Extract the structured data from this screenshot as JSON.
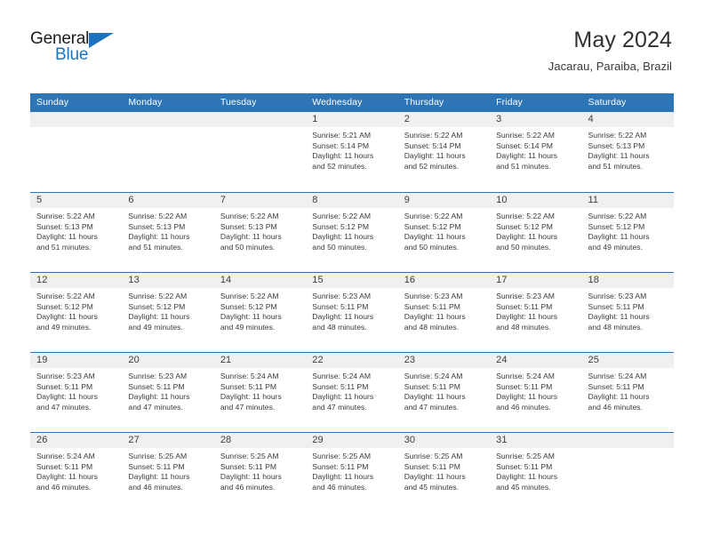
{
  "brand": {
    "name_part1": "General",
    "name_part2": "Blue",
    "logo_icon": "triangle-icon",
    "blue": "#1e73be"
  },
  "header": {
    "title": "May 2024",
    "subtitle": "Jacarau, Paraiba, Brazil"
  },
  "theme": {
    "header_blue": "#2e75b6",
    "band_gray": "#f0f0f0",
    "text": "#3a3a3a"
  },
  "calendar": {
    "day_headers": [
      "Sunday",
      "Monday",
      "Tuesday",
      "Wednesday",
      "Thursday",
      "Friday",
      "Saturday"
    ],
    "weeks": [
      [
        {
          "day": "",
          "sunrise": "",
          "sunset": "",
          "daylight1": "",
          "daylight2": ""
        },
        {
          "day": "",
          "sunrise": "",
          "sunset": "",
          "daylight1": "",
          "daylight2": ""
        },
        {
          "day": "",
          "sunrise": "",
          "sunset": "",
          "daylight1": "",
          "daylight2": ""
        },
        {
          "day": "1",
          "sunrise": "Sunrise: 5:21 AM",
          "sunset": "Sunset: 5:14 PM",
          "daylight1": "Daylight: 11 hours",
          "daylight2": "and 52 minutes."
        },
        {
          "day": "2",
          "sunrise": "Sunrise: 5:22 AM",
          "sunset": "Sunset: 5:14 PM",
          "daylight1": "Daylight: 11 hours",
          "daylight2": "and 52 minutes."
        },
        {
          "day": "3",
          "sunrise": "Sunrise: 5:22 AM",
          "sunset": "Sunset: 5:14 PM",
          "daylight1": "Daylight: 11 hours",
          "daylight2": "and 51 minutes."
        },
        {
          "day": "4",
          "sunrise": "Sunrise: 5:22 AM",
          "sunset": "Sunset: 5:13 PM",
          "daylight1": "Daylight: 11 hours",
          "daylight2": "and 51 minutes."
        }
      ],
      [
        {
          "day": "5",
          "sunrise": "Sunrise: 5:22 AM",
          "sunset": "Sunset: 5:13 PM",
          "daylight1": "Daylight: 11 hours",
          "daylight2": "and 51 minutes."
        },
        {
          "day": "6",
          "sunrise": "Sunrise: 5:22 AM",
          "sunset": "Sunset: 5:13 PM",
          "daylight1": "Daylight: 11 hours",
          "daylight2": "and 51 minutes."
        },
        {
          "day": "7",
          "sunrise": "Sunrise: 5:22 AM",
          "sunset": "Sunset: 5:13 PM",
          "daylight1": "Daylight: 11 hours",
          "daylight2": "and 50 minutes."
        },
        {
          "day": "8",
          "sunrise": "Sunrise: 5:22 AM",
          "sunset": "Sunset: 5:12 PM",
          "daylight1": "Daylight: 11 hours",
          "daylight2": "and 50 minutes."
        },
        {
          "day": "9",
          "sunrise": "Sunrise: 5:22 AM",
          "sunset": "Sunset: 5:12 PM",
          "daylight1": "Daylight: 11 hours",
          "daylight2": "and 50 minutes."
        },
        {
          "day": "10",
          "sunrise": "Sunrise: 5:22 AM",
          "sunset": "Sunset: 5:12 PM",
          "daylight1": "Daylight: 11 hours",
          "daylight2": "and 50 minutes."
        },
        {
          "day": "11",
          "sunrise": "Sunrise: 5:22 AM",
          "sunset": "Sunset: 5:12 PM",
          "daylight1": "Daylight: 11 hours",
          "daylight2": "and 49 minutes."
        }
      ],
      [
        {
          "day": "12",
          "sunrise": "Sunrise: 5:22 AM",
          "sunset": "Sunset: 5:12 PM",
          "daylight1": "Daylight: 11 hours",
          "daylight2": "and 49 minutes."
        },
        {
          "day": "13",
          "sunrise": "Sunrise: 5:22 AM",
          "sunset": "Sunset: 5:12 PM",
          "daylight1": "Daylight: 11 hours",
          "daylight2": "and 49 minutes."
        },
        {
          "day": "14",
          "sunrise": "Sunrise: 5:22 AM",
          "sunset": "Sunset: 5:12 PM",
          "daylight1": "Daylight: 11 hours",
          "daylight2": "and 49 minutes."
        },
        {
          "day": "15",
          "sunrise": "Sunrise: 5:23 AM",
          "sunset": "Sunset: 5:11 PM",
          "daylight1": "Daylight: 11 hours",
          "daylight2": "and 48 minutes."
        },
        {
          "day": "16",
          "sunrise": "Sunrise: 5:23 AM",
          "sunset": "Sunset: 5:11 PM",
          "daylight1": "Daylight: 11 hours",
          "daylight2": "and 48 minutes."
        },
        {
          "day": "17",
          "sunrise": "Sunrise: 5:23 AM",
          "sunset": "Sunset: 5:11 PM",
          "daylight1": "Daylight: 11 hours",
          "daylight2": "and 48 minutes."
        },
        {
          "day": "18",
          "sunrise": "Sunrise: 5:23 AM",
          "sunset": "Sunset: 5:11 PM",
          "daylight1": "Daylight: 11 hours",
          "daylight2": "and 48 minutes."
        }
      ],
      [
        {
          "day": "19",
          "sunrise": "Sunrise: 5:23 AM",
          "sunset": "Sunset: 5:11 PM",
          "daylight1": "Daylight: 11 hours",
          "daylight2": "and 47 minutes."
        },
        {
          "day": "20",
          "sunrise": "Sunrise: 5:23 AM",
          "sunset": "Sunset: 5:11 PM",
          "daylight1": "Daylight: 11 hours",
          "daylight2": "and 47 minutes."
        },
        {
          "day": "21",
          "sunrise": "Sunrise: 5:24 AM",
          "sunset": "Sunset: 5:11 PM",
          "daylight1": "Daylight: 11 hours",
          "daylight2": "and 47 minutes."
        },
        {
          "day": "22",
          "sunrise": "Sunrise: 5:24 AM",
          "sunset": "Sunset: 5:11 PM",
          "daylight1": "Daylight: 11 hours",
          "daylight2": "and 47 minutes."
        },
        {
          "day": "23",
          "sunrise": "Sunrise: 5:24 AM",
          "sunset": "Sunset: 5:11 PM",
          "daylight1": "Daylight: 11 hours",
          "daylight2": "and 47 minutes."
        },
        {
          "day": "24",
          "sunrise": "Sunrise: 5:24 AM",
          "sunset": "Sunset: 5:11 PM",
          "daylight1": "Daylight: 11 hours",
          "daylight2": "and 46 minutes."
        },
        {
          "day": "25",
          "sunrise": "Sunrise: 5:24 AM",
          "sunset": "Sunset: 5:11 PM",
          "daylight1": "Daylight: 11 hours",
          "daylight2": "and 46 minutes."
        }
      ],
      [
        {
          "day": "26",
          "sunrise": "Sunrise: 5:24 AM",
          "sunset": "Sunset: 5:11 PM",
          "daylight1": "Daylight: 11 hours",
          "daylight2": "and 46 minutes."
        },
        {
          "day": "27",
          "sunrise": "Sunrise: 5:25 AM",
          "sunset": "Sunset: 5:11 PM",
          "daylight1": "Daylight: 11 hours",
          "daylight2": "and 46 minutes."
        },
        {
          "day": "28",
          "sunrise": "Sunrise: 5:25 AM",
          "sunset": "Sunset: 5:11 PM",
          "daylight1": "Daylight: 11 hours",
          "daylight2": "and 46 minutes."
        },
        {
          "day": "29",
          "sunrise": "Sunrise: 5:25 AM",
          "sunset": "Sunset: 5:11 PM",
          "daylight1": "Daylight: 11 hours",
          "daylight2": "and 46 minutes."
        },
        {
          "day": "30",
          "sunrise": "Sunrise: 5:25 AM",
          "sunset": "Sunset: 5:11 PM",
          "daylight1": "Daylight: 11 hours",
          "daylight2": "and 45 minutes."
        },
        {
          "day": "31",
          "sunrise": "Sunrise: 5:25 AM",
          "sunset": "Sunset: 5:11 PM",
          "daylight1": "Daylight: 11 hours",
          "daylight2": "and 45 minutes."
        },
        {
          "day": "",
          "sunrise": "",
          "sunset": "",
          "daylight1": "",
          "daylight2": ""
        }
      ]
    ]
  }
}
